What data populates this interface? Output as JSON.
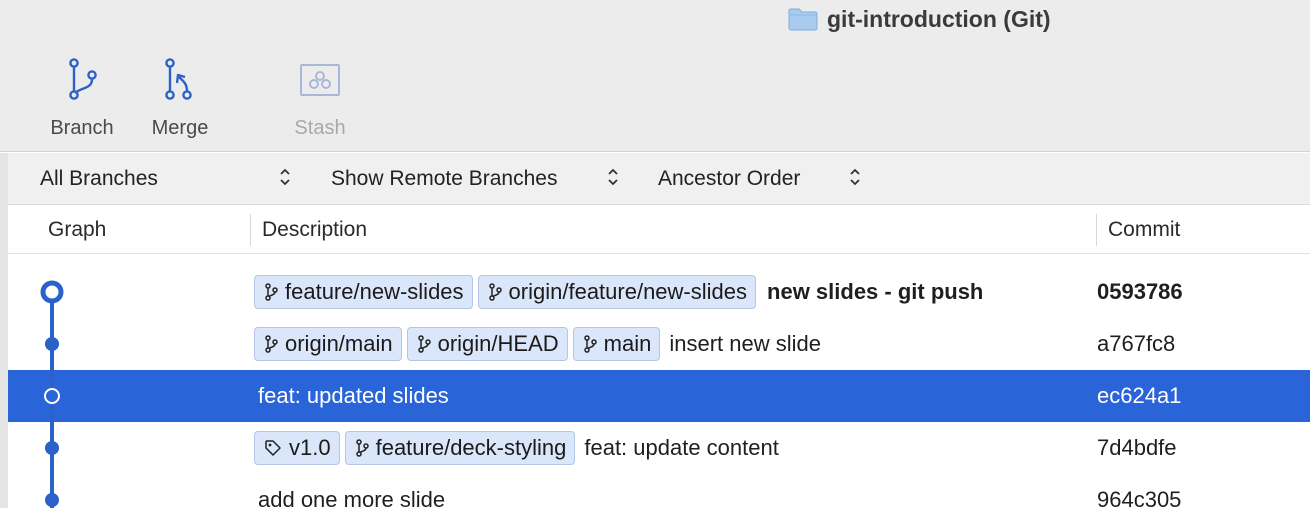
{
  "window": {
    "title": "git-introduction (Git)",
    "title_icon": "folder-icon"
  },
  "toolbar": {
    "branch_label": "Branch",
    "merge_label": "Merge",
    "stash_label": "Stash"
  },
  "filters": {
    "branches": "All Branches",
    "remote": "Show Remote Branches",
    "order": "Ancestor Order"
  },
  "columns": {
    "graph": "Graph",
    "description": "Description",
    "commit": "Commit"
  },
  "colors": {
    "accent": "#2964d9",
    "graph_line": "#2a62c9",
    "tag_bg": "#dae6fa"
  },
  "commits": [
    {
      "refs": [
        {
          "type": "branch",
          "name": "feature/new-slides"
        },
        {
          "type": "branch",
          "name": "origin/feature/new-slides"
        }
      ],
      "message": "new slides - git push",
      "hash": "0593786",
      "is_head": true,
      "selected": false
    },
    {
      "refs": [
        {
          "type": "branch",
          "name": "origin/main"
        },
        {
          "type": "branch",
          "name": "origin/HEAD"
        },
        {
          "type": "branch",
          "name": "main"
        }
      ],
      "message": "insert new slide",
      "hash": "a767fc8",
      "is_head": false,
      "selected": false
    },
    {
      "refs": [],
      "message": "feat: updated slides",
      "hash": "ec624a1",
      "is_head": false,
      "selected": true
    },
    {
      "refs": [
        {
          "type": "tag",
          "name": "v1.0"
        },
        {
          "type": "branch",
          "name": "feature/deck-styling"
        }
      ],
      "message": "feat: update content",
      "hash": "7d4bdfe",
      "is_head": false,
      "selected": false
    },
    {
      "refs": [],
      "message": "add one more slide",
      "hash": "964c305",
      "is_head": false,
      "selected": false
    }
  ]
}
